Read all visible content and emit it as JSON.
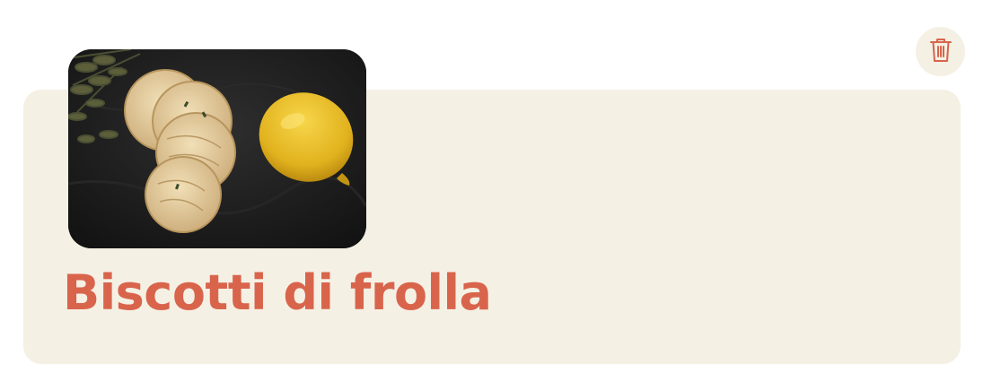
{
  "recipe": {
    "title": "Biscotti di frolla"
  },
  "image": {
    "alt": ""
  },
  "icons": {
    "delete": "trash-icon"
  },
  "colors": {
    "card_background": "#f5f0e4",
    "title": "#d9644c",
    "icon": "#d9644c"
  }
}
